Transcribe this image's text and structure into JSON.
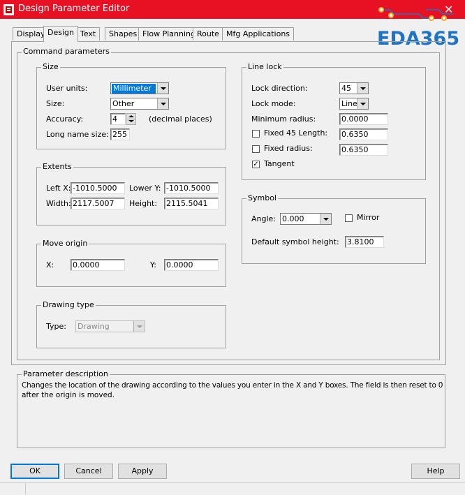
{
  "window": {
    "title": "Design Parameter Editor",
    "logo_text": "EDA365"
  },
  "tabs": [
    {
      "label": "Display"
    },
    {
      "label": "Design"
    },
    {
      "label": "Text"
    },
    {
      "label": "Shapes"
    },
    {
      "label": "Flow Planning"
    },
    {
      "label": "Route"
    },
    {
      "label": "Mfg Applications"
    }
  ],
  "active_tab": "Design",
  "command_parameters": {
    "title": "Command parameters",
    "size": {
      "title": "Size",
      "user_units_label": "User units:",
      "user_units_value": "Millimeter",
      "size_label": "Size:",
      "size_value": "Other",
      "accuracy_label": "Accuracy:",
      "accuracy_value": "4",
      "accuracy_suffix": "(decimal places)",
      "long_name_label": "Long name size:",
      "long_name_value": "255"
    },
    "extents": {
      "title": "Extents",
      "left_x_label": "Left X:",
      "left_x_value": "-1010.5000",
      "lower_y_label": "Lower Y:",
      "lower_y_value": "-1010.5000",
      "width_label": "Width:",
      "width_value": "2117.5007",
      "height_label": "Height:",
      "height_value": "2115.5041"
    },
    "move_origin": {
      "title": "Move origin",
      "x_label": "X:",
      "x_value": "0.0000",
      "y_label": "Y:",
      "y_value": "0.0000"
    },
    "drawing_type": {
      "title": "Drawing type",
      "type_label": "Type:",
      "type_value": "Drawing"
    },
    "line_lock": {
      "title": "Line lock",
      "lock_direction_label": "Lock direction:",
      "lock_direction_value": "45",
      "lock_mode_label": "Lock mode:",
      "lock_mode_value": "Line",
      "min_radius_label": "Minimum radius:",
      "min_radius_value": "0.0000",
      "fixed45_label": "Fixed 45 Length:",
      "fixed45_value": "0.6350",
      "fixed45_checked": false,
      "fixed_radius_label": "Fixed radius:",
      "fixed_radius_value": "0.6350",
      "fixed_radius_checked": false,
      "tangent_label": "Tangent",
      "tangent_checked": true
    },
    "symbol": {
      "title": "Symbol",
      "angle_label": "Angle:",
      "angle_value": "0.000",
      "mirror_label": "Mirror",
      "mirror_checked": false,
      "default_height_label": "Default symbol height:",
      "default_height_value": "3.8100"
    }
  },
  "parameter_description": {
    "title": "Parameter description",
    "text_line1": "Changes the location of the drawing according to the values you enter in the X and Y boxes. The field is then reset to 0",
    "text_line2": "after the origin is moved."
  },
  "buttons": {
    "ok": "OK",
    "cancel": "Cancel",
    "apply": "Apply",
    "help": "Help"
  },
  "icons": {
    "app": "app-icon",
    "close": "close-icon",
    "check": "checkmark-icon",
    "dropdown": "chevron-down-icon"
  },
  "colors": {
    "titlebar": "#e81123",
    "selection": "#0078d7",
    "logo": "#1e74c2",
    "logo_dots": "#f5a623"
  }
}
